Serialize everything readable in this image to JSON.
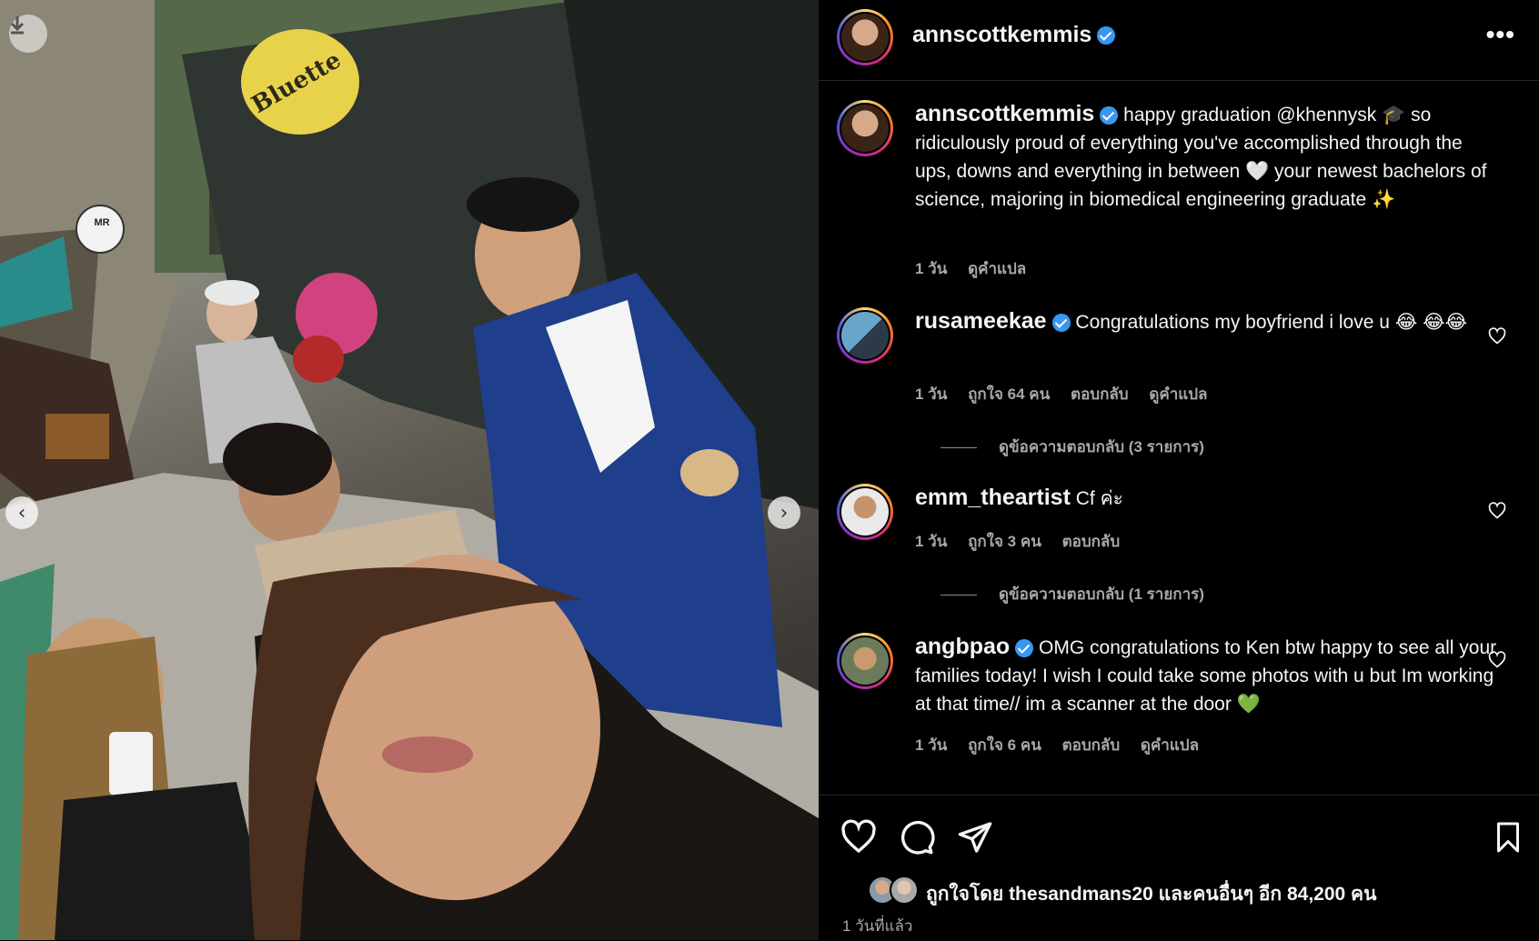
{
  "post": {
    "username": "annscottkemmis",
    "caption": "happy graduation @khennysk 🎓 so ridiculously proud of everything you've accomplished through the ups, downs and everything in between 🤍 your newest bachelors of science, majoring in biomedical engineering graduate ✨",
    "caption_time": "1 วัน",
    "caption_translate": "ดูคำแปล",
    "liked_by_prefix": "ถูกใจโดย",
    "liked_by_user": "thesandmans20",
    "liked_by_suffix": "และคนอื่นๆ อีก 84,200 คน",
    "posted_time": "1 วันที่แล้ว"
  },
  "photo": {
    "shop_sign": "Bluette",
    "mr_sign": "MR"
  },
  "comments": [
    {
      "username": "rusameekae",
      "verified": true,
      "text": "Congratulations my boyfriend i love u 😂 😂😂",
      "time": "1 วัน",
      "likes": "ถูกใจ 64 คน",
      "reply": "ตอบกลับ",
      "translate": "ดูคำแปล",
      "view_replies": "ดูข้อความตอบกลับ (3 รายการ)"
    },
    {
      "username": "emm_theartist",
      "verified": false,
      "text": "Cf ค่ะ",
      "time": "1 วัน",
      "likes": "ถูกใจ 3 คน",
      "reply": "ตอบกลับ",
      "view_replies": "ดูข้อความตอบกลับ (1 รายการ)"
    },
    {
      "username": "angbpao",
      "verified": true,
      "text": "OMG congratulations to Ken btw happy to see all your families today! I wish I could take some photos with u but Im working at that time// im a scanner at the door 💚",
      "time": "1 วัน",
      "likes": "ถูกใจ 6 คน",
      "reply": "ตอบกลับ",
      "translate": "ดูคำแปล"
    }
  ],
  "icons": {
    "more": "more-options-icon",
    "like": "heart-icon",
    "comment": "comment-bubble-icon",
    "share": "paper-plane-icon",
    "save": "bookmark-icon",
    "download": "download-arrow-icon",
    "prev": "chevron-left-icon",
    "next": "chevron-right-icon"
  },
  "colors": {
    "background": "#000000",
    "verified": "#3897f0",
    "secondary_text": "#a8a8a8"
  }
}
